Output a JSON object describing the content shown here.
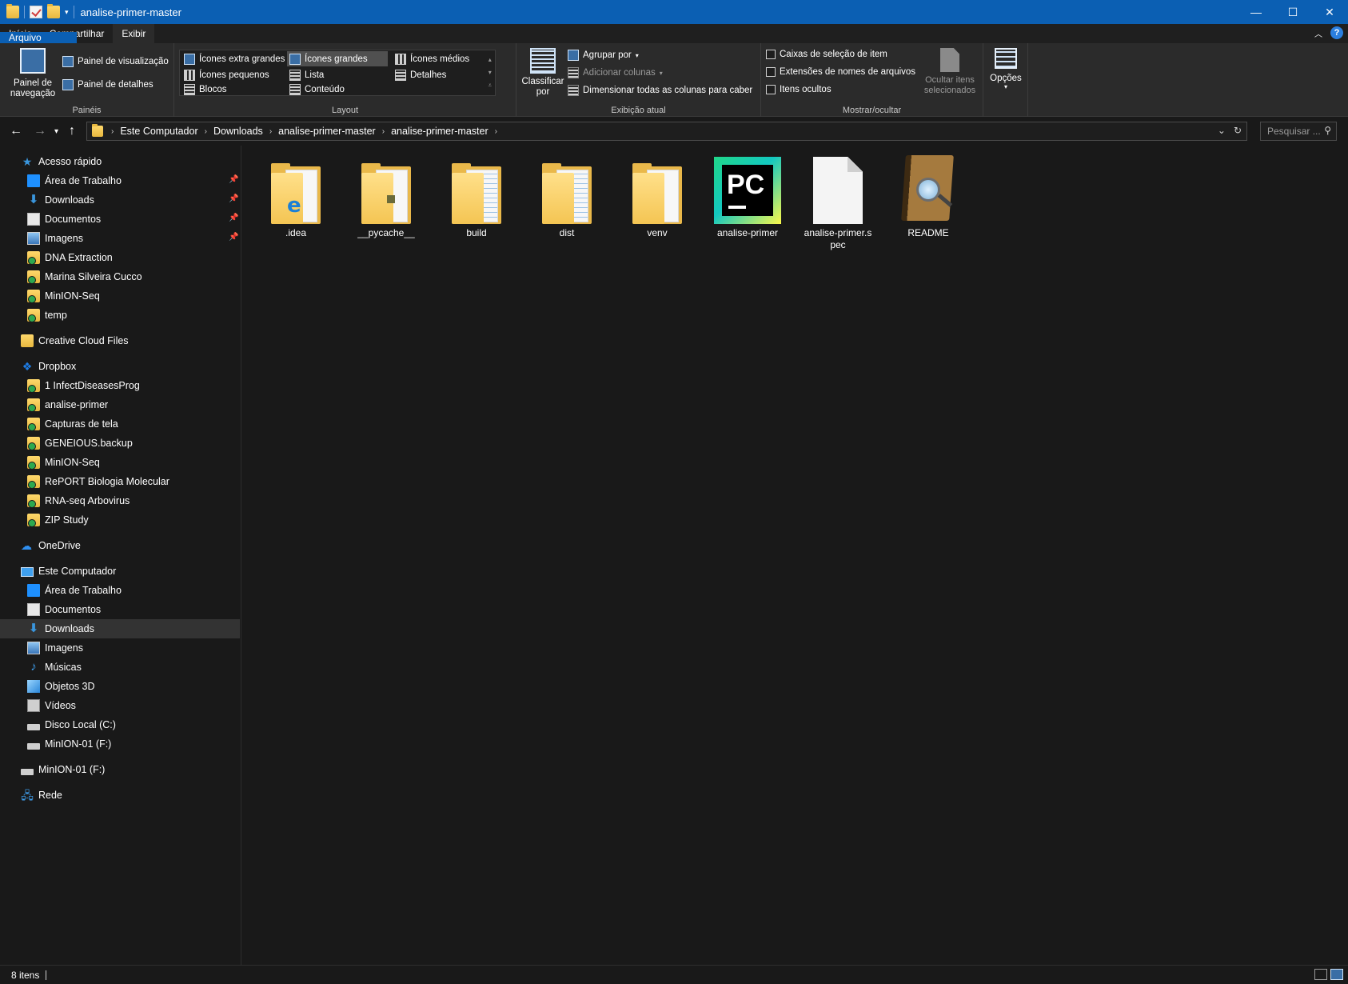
{
  "window": {
    "title": "analise-primer-master",
    "controls": {
      "minimize": "—",
      "maximize": "☐",
      "close": "✕"
    }
  },
  "ribbon_tabs": [
    "Arquivo",
    "Início",
    "Compartilhar",
    "Exibir"
  ],
  "ribbon": {
    "paineis": {
      "label": "Painéis",
      "nav_pane": "Painel de navegação",
      "preview": "Painel de visualização",
      "details": "Painel de detalhes"
    },
    "layout": {
      "label": "Layout",
      "extra_large": "Ícones extra grandes",
      "large": "Ícones grandes",
      "medium": "Ícones médios",
      "small": "Ícones pequenos",
      "list": "Lista",
      "details": "Detalhes",
      "tiles": "Blocos",
      "content": "Conteúdo"
    },
    "current_view": {
      "label": "Exibição atual",
      "sort_by": "Classificar por",
      "group_by": "Agrupar por",
      "add_columns": "Adicionar colunas",
      "size_columns": "Dimensionar todas as colunas para caber"
    },
    "show_hide": {
      "label": "Mostrar/ocultar",
      "checkboxes": "Caixas de seleção de item",
      "extensions": "Extensões de nomes de arquivos",
      "hidden": "Itens ocultos",
      "hide_selected": "Ocultar itens selecionados"
    },
    "options": {
      "label": "Opções"
    }
  },
  "address": {
    "crumbs": [
      "Este Computador",
      "Downloads",
      "analise-primer-master",
      "analise-primer-master"
    ],
    "search_placeholder": "Pesquisar ..."
  },
  "sidebar": {
    "quick_access": "Acesso rápido",
    "quick_items": [
      {
        "label": "Área de Trabalho",
        "pinned": true
      },
      {
        "label": "Downloads",
        "pinned": true
      },
      {
        "label": "Documentos",
        "pinned": true
      },
      {
        "label": "Imagens",
        "pinned": true
      },
      {
        "label": "DNA Extraction",
        "pinned": false
      },
      {
        "label": "Marina Silveira Cucco",
        "pinned": false
      },
      {
        "label": "MinION-Seq",
        "pinned": false
      },
      {
        "label": "temp",
        "pinned": false
      }
    ],
    "creative_cloud": "Creative Cloud Files",
    "dropbox": "Dropbox",
    "dropbox_items": [
      "1 InfectDiseasesProg",
      "analise-primer",
      "Capturas de tela",
      "GENEIOUS.backup",
      "MinION-Seq",
      "RePORT Biologia Molecular",
      "RNA-seq Arbovirus",
      "ZIP Study"
    ],
    "onedrive": "OneDrive",
    "this_pc": "Este Computador",
    "pc_items": [
      "Área de Trabalho",
      "Documentos",
      "Downloads",
      "Imagens",
      "Músicas",
      "Objetos 3D",
      "Vídeos",
      "Disco Local (C:)",
      "MinION-01 (F:)"
    ],
    "selected_pc_item": "Downloads",
    "usb_drive": "MinION-01 (F:)",
    "network": "Rede"
  },
  "files": [
    {
      "name": ".idea",
      "kind": "folder-edge"
    },
    {
      "name": "__pycache__",
      "kind": "folder-pyc"
    },
    {
      "name": "build",
      "kind": "folder-lines"
    },
    {
      "name": "dist",
      "kind": "folder-lines"
    },
    {
      "name": "venv",
      "kind": "folder-blank"
    },
    {
      "name": "analise-primer",
      "kind": "pycharm-exe"
    },
    {
      "name": "analise-primer.spec",
      "kind": "blank-file"
    },
    {
      "name": "README",
      "kind": "book"
    }
  ],
  "pycharm_logo_text": "PC",
  "status": {
    "count": "8 itens"
  },
  "colors": {
    "accent": "#0b5fb3",
    "background": "#191919",
    "ribbon": "#2b2b2b"
  }
}
